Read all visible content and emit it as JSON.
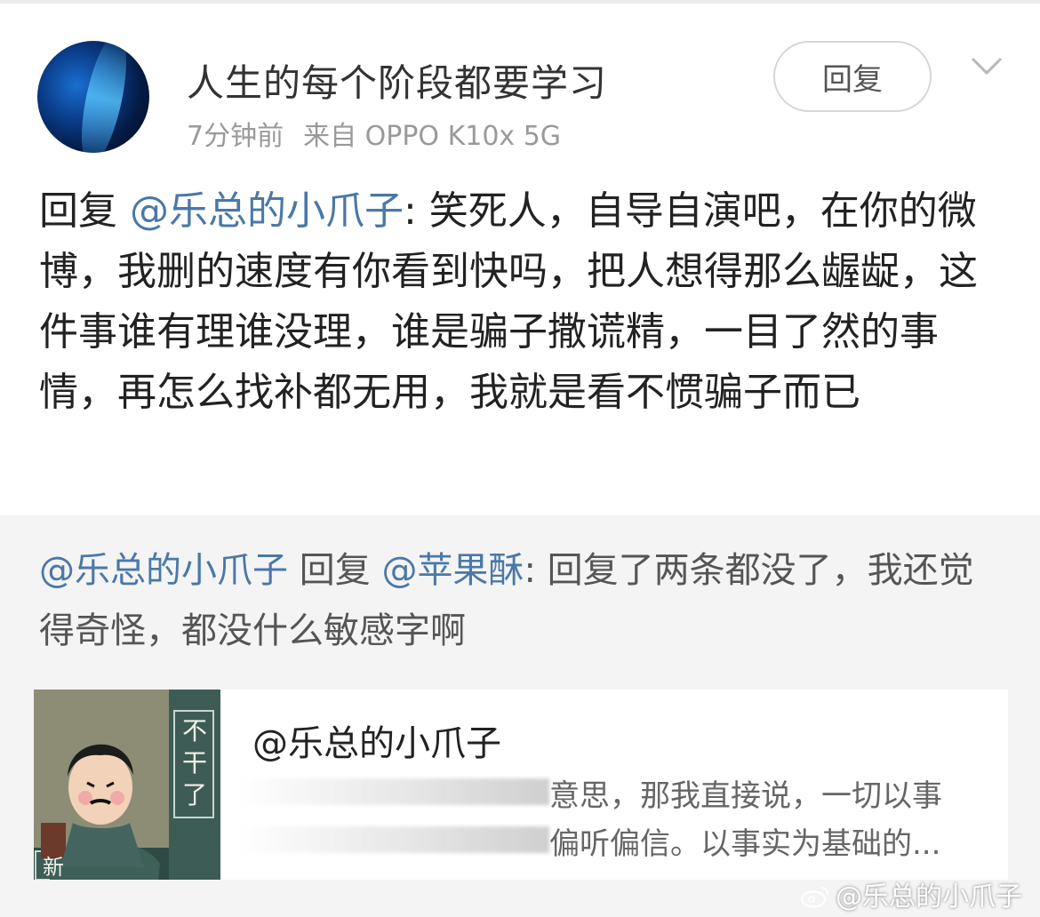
{
  "post": {
    "author": "人生的每个阶段都要学习",
    "time": "7分钟前",
    "source": "来自 OPPO K10x 5G",
    "reply_button": "回复",
    "comment_prefix": "回复 ",
    "comment_mention": "@乐总的小爪子",
    "comment_body": ": 笑死人，自导自演吧，在你的微博，我删的速度有你看到快吗，把人想得那么龌龊，这件事谁有理谁没理，谁是骗子撒谎精，一目了然的事情，再怎么找补都无用，我就是看不惯骗子而已"
  },
  "quoted": {
    "from_mention": "@乐总的小爪子",
    "reply_word": " 回复 ",
    "to_mention": "@苹果酥",
    "body": ": 回复了两条都没了，我还觉得奇怪，都没什么敏感字啊"
  },
  "card": {
    "name": "@乐总的小爪子",
    "line1": "意思，那我直接说，一切以事",
    "line2": "偏听偏信。以事实为基础的...",
    "thumb_vertical_text": "不干了",
    "thumb_corner_char": "新"
  },
  "watermark": "@乐总的小爪子",
  "icons": {
    "chevron": "chevron-down-icon",
    "watermark": "weibo-logo-icon"
  },
  "colors": {
    "mention": "#4a78a8",
    "grey_bg": "#f4f4f4",
    "thumb_bg": "#8a8a73"
  }
}
